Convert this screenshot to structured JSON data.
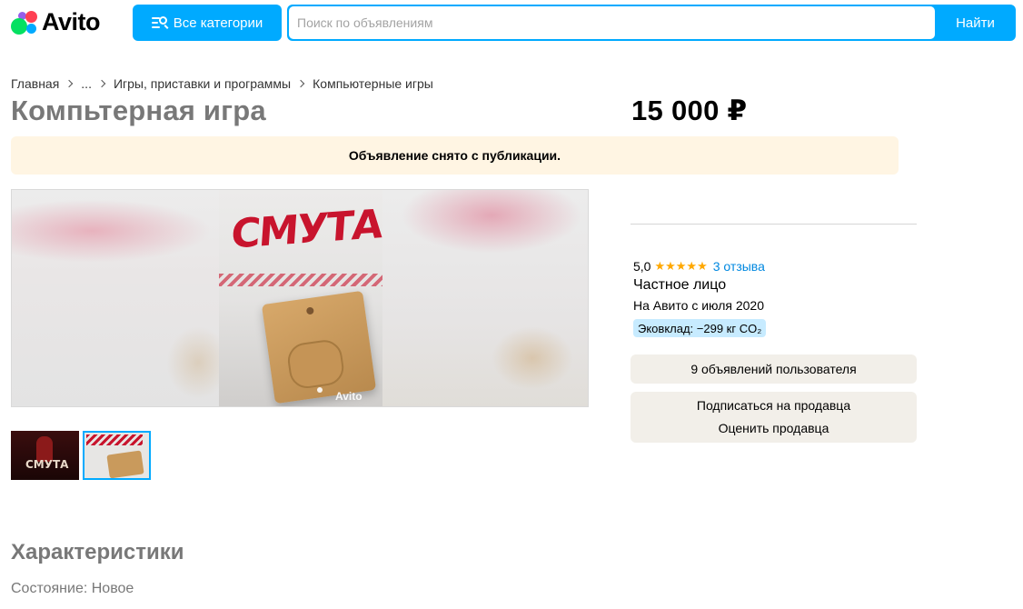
{
  "header": {
    "logo_text": "Avito",
    "categories_label": "Все категории",
    "search_placeholder": "Поиск по объявлениям",
    "search_button": "Найти"
  },
  "breadcrumb": [
    {
      "label": "Главная"
    },
    {
      "label": "..."
    },
    {
      "label": "Игры, приставки и программы"
    },
    {
      "label": "Компьютерные игры"
    }
  ],
  "listing": {
    "title": "Компьтерная игра",
    "price": "15 000 ₽",
    "notice": "Объявление снято с публикации."
  },
  "gallery": {
    "main_photo_art_text": "СМУТА",
    "watermark": "Avito",
    "thumbnails": [
      {
        "art_text": "СМУТА",
        "selected": false
      },
      {
        "art_text": "",
        "selected": true
      }
    ]
  },
  "seller": {
    "rating": "5,0",
    "stars": "★★★★★",
    "reviews": "3 отзыва",
    "type": "Частное лицо",
    "since": "На Авито с июля 2020",
    "eco": "Эковклад: −299 кг CO₂",
    "ads_button": "9 объявлений пользователя",
    "subscribe_button": "Подписаться на продавца",
    "rate_button": "Оценить продавца"
  },
  "characteristics": {
    "title": "Характеристики",
    "items": [
      {
        "label": "Состояние:",
        "value": "Новое"
      }
    ]
  },
  "colors": {
    "accent": "#00aaff",
    "notice_bg": "#fff5e3",
    "button_grey": "#f2efe9",
    "star": "#ffa800",
    "link": "#0088e0"
  },
  "icons": [
    "avito-logo-icon",
    "categories-search-icon",
    "chevron-right-icon",
    "star-icon"
  ]
}
